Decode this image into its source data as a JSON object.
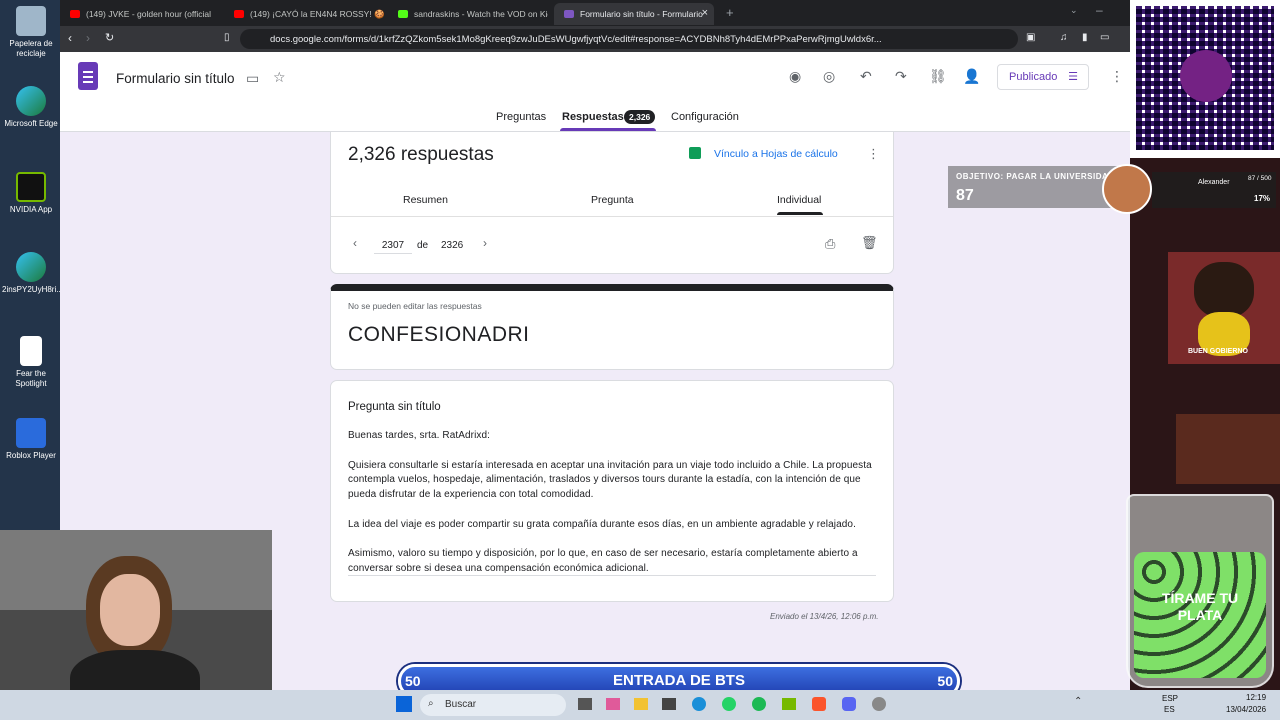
{
  "desktop": {
    "icons": [
      {
        "label": "Papelera de reciclaje"
      },
      {
        "label": "Microsoft Edge"
      },
      {
        "label": "NVIDIA App"
      },
      {
        "label": "2insPY2UyH8ri..."
      },
      {
        "label": "Fear the Spotlight"
      },
      {
        "label": "Roblox Player"
      }
    ]
  },
  "browser": {
    "tabs": [
      {
        "label": "(149) JVKE - golden hour (official",
        "color": "#ff0000"
      },
      {
        "label": "(149) ¡CAYÓ la EN4N4 ROSSY! 🍪",
        "color": "#ff0000"
      },
      {
        "label": "sandraskins - Watch the VOD on Kick",
        "color": "#53fc18"
      },
      {
        "label": "Formulario sin título - Formulario",
        "color": "#7e57c2"
      }
    ],
    "url": "docs.google.com/forms/d/1krfZzQZkom5sek1Mo8gKreeq9zwJuDEsWUgwfjyqtVc/edit#response=ACYDBNh8Tyh4dEMrPPxaPerwRjmgUwldx6r..."
  },
  "forms": {
    "title": "Formulario sin título",
    "publish_label": "Publicado",
    "nav_tabs": [
      "Preguntas",
      "Respuestas",
      "Configuración"
    ],
    "response_count_badge": "2,326",
    "responses_title": "2,326 respuestas",
    "sheets_link": "Vínculo a Hojas de cálculo",
    "sub_tabs": [
      "Resumen",
      "Pregunta",
      "Individual"
    ],
    "pager": {
      "current": "2307",
      "of": "de",
      "total": "2326"
    },
    "cannot_edit": "No se pueden editar las respuestas",
    "form_name": "CONFESIONADRI",
    "question_title": "Pregunta sin título",
    "answer_paragraphs": [
      "Buenas tardes, srta. RatAdrixd:",
      "Quisiera consultarle si estaría interesada en aceptar una invitación para un viaje todo incluido a Chile. La propuesta contempla vuelos, hospedaje, alimentación, traslados y diversos tours durante la estadía, con la intención de que pueda disfrutar de la experiencia con total comodidad.",
      "La idea del viaje es poder compartir su grata compañía durante esos días, en un ambiente agradable y relajado.",
      "Asimismo, valoro su tiempo y disposición, por lo que, en caso de ser necesario, estaría completamente abierto a conversar sobre si desea una compensación económica adicional."
    ],
    "sent_at": "Enviado el 13/4/26, 12:06 p.m."
  },
  "overlay": {
    "goal_label": "OBJETIVO: PAGAR LA UNIVERSIDAD",
    "goal_value": "87",
    "donor_name": "Alexander",
    "donor_progress": "87 / 500",
    "donor_percent": "17%",
    "glass_text": "TÍRAME TU PLATA",
    "banner_text": "ENTRADA DE BTS",
    "banner_left": "50",
    "banner_right": "50",
    "dog_caption": "BUEN GOBIERNO"
  },
  "taskbar": {
    "search_placeholder": "Buscar",
    "lang_top": "ESP",
    "lang_bottom": "ES",
    "time": "12:19",
    "date": "13/04/2026"
  }
}
